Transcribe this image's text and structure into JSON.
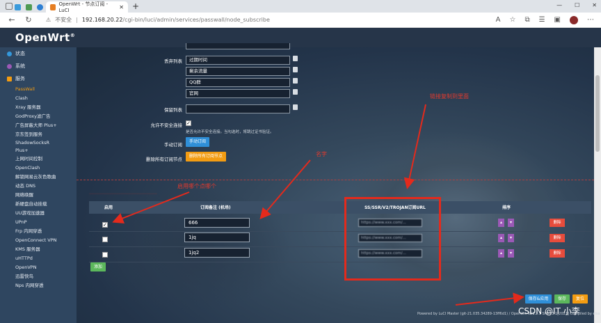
{
  "browser": {
    "tab_title": "OpenWrt - 节点订阅 - LuCI",
    "security_label": "不安全",
    "url_host": "192.168.20.22",
    "url_path": "/cgi-bin/luci/admin/services/passwall/node_subscribe"
  },
  "header": {
    "brand": "OpenWrt",
    "brand_mark": "®"
  },
  "sidebar": {
    "top": [
      {
        "label": "状态",
        "color": "#3498db"
      },
      {
        "label": "系统",
        "color": "#9b59b6"
      },
      {
        "label": "服务",
        "color": "#f39c12"
      }
    ],
    "items": [
      "PassWall",
      "Clash",
      "Xray 服务器",
      "GodProxy滤广告",
      "广告屏蔽大师 Plus+",
      "京东签到服务",
      "ShadowSocksR",
      "Plus+",
      "上网时间控制",
      "OpenClash",
      "解锁网易云灰色歌曲",
      "动态 DNS",
      "网络唤醒",
      "新硬盘自动挂载",
      "UU游戏加速器",
      "UPnP",
      "Frp 内网穿透",
      "OpenConnect VPN",
      "KMS 服务器",
      "uHTTPd",
      "OpenVPN",
      "迅雷快鸟",
      "Nps 内网穿透"
    ]
  },
  "form": {
    "discard_label": "丢弃列表",
    "discard_values": [
      "过期时间",
      "剩余流量",
      "QQ群",
      "官网"
    ],
    "keep_label": "保留列表",
    "keep_value": "",
    "insecure_label": "允许不安全连接",
    "insecure_hint": "是否允许不安全连接。当勾选时，将跳过证书验证。",
    "manual_label": "手动订阅",
    "manual_button": "手动订阅",
    "delete_label": "删除所有订阅节点",
    "delete_button": "删除所有订阅节点"
  },
  "table": {
    "headers": {
      "enable": "启用",
      "remark": "订阅备注 (机场)",
      "url": "SS/SSR/V2/TROJAN订阅URL",
      "sort": "排序"
    },
    "rows": [
      {
        "enabled": true,
        "remark": "666",
        "url": "https://www.xxx.com/..."
      },
      {
        "enabled": false,
        "remark": "1jq",
        "url": "https://www.xxx.com/..."
      },
      {
        "enabled": false,
        "remark": "1jq2",
        "url": "https://www.xxx.com/..."
      }
    ],
    "delete_label": "删除",
    "add_label": "添加"
  },
  "actions": {
    "save_apply": "保存&应用",
    "save": "保存",
    "reset": "复位"
  },
  "footer": "Powered by LuCI Master (git-21.035.34289-13ff6d1) / OpenWrt R21.2.1 SPP v3.1[2021] Compiled by elsa",
  "watermark": "CSDN @IT 小李",
  "annotations": {
    "link": "链接复制到里面",
    "name": "名字",
    "enable": "启用哪个点哪个"
  }
}
